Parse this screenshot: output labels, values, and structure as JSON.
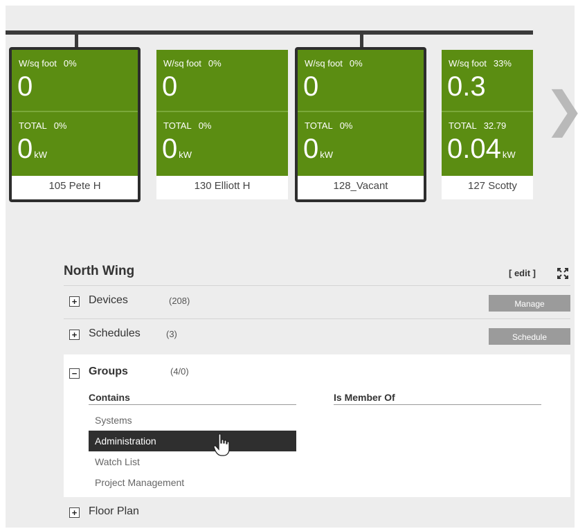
{
  "rooms": [
    {
      "metric_label": "W/sq foot",
      "metric_pct": "0%",
      "metric_value": "0",
      "total_label": "TOTAL",
      "total_pct": "0%",
      "total_value": "0",
      "total_unit": "kW",
      "name": "105 Pete H",
      "selected": true
    },
    {
      "metric_label": "W/sq foot",
      "metric_pct": "0%",
      "metric_value": "0",
      "total_label": "TOTAL",
      "total_pct": "0%",
      "total_value": "0",
      "total_unit": "kW",
      "name": "130 Elliott H",
      "selected": false
    },
    {
      "metric_label": "W/sq foot",
      "metric_pct": "0%",
      "metric_value": "0",
      "total_label": "TOTAL",
      "total_pct": "0%",
      "total_value": "0",
      "total_unit": "kW",
      "name": "128_Vacant",
      "selected": true
    },
    {
      "metric_label": "W/sq foot",
      "metric_pct": "33%",
      "metric_value": "0.3",
      "total_label": "TOTAL",
      "total_pct": "32.79",
      "total_value": "0.04",
      "total_unit": "kW",
      "name": "127 Scotty",
      "selected": false
    }
  ],
  "section": {
    "title": "North Wing",
    "edit_label": "[ edit ]",
    "devices": {
      "label": "Devices",
      "count": "(208)",
      "button": "Manage"
    },
    "schedules": {
      "label": "Schedules",
      "count": "(3)",
      "button": "Schedule"
    },
    "groups": {
      "label": "Groups",
      "count": "(4/0)",
      "contains_header": "Contains",
      "member_header": "Is Member Of",
      "items": [
        "Systems",
        "Administration",
        "Watch List",
        "Project Management"
      ],
      "active_item": "Administration"
    },
    "floor_plan": {
      "label": "Floor Plan"
    }
  },
  "colors": {
    "tile_green": "#5b8d12",
    "button_gray": "#9b9b9b",
    "selected_row": "#2f2f2f"
  },
  "icons": {
    "expand": "expand-icon",
    "next": "chevron-right-icon",
    "cursor": "hand-pointer-icon"
  }
}
